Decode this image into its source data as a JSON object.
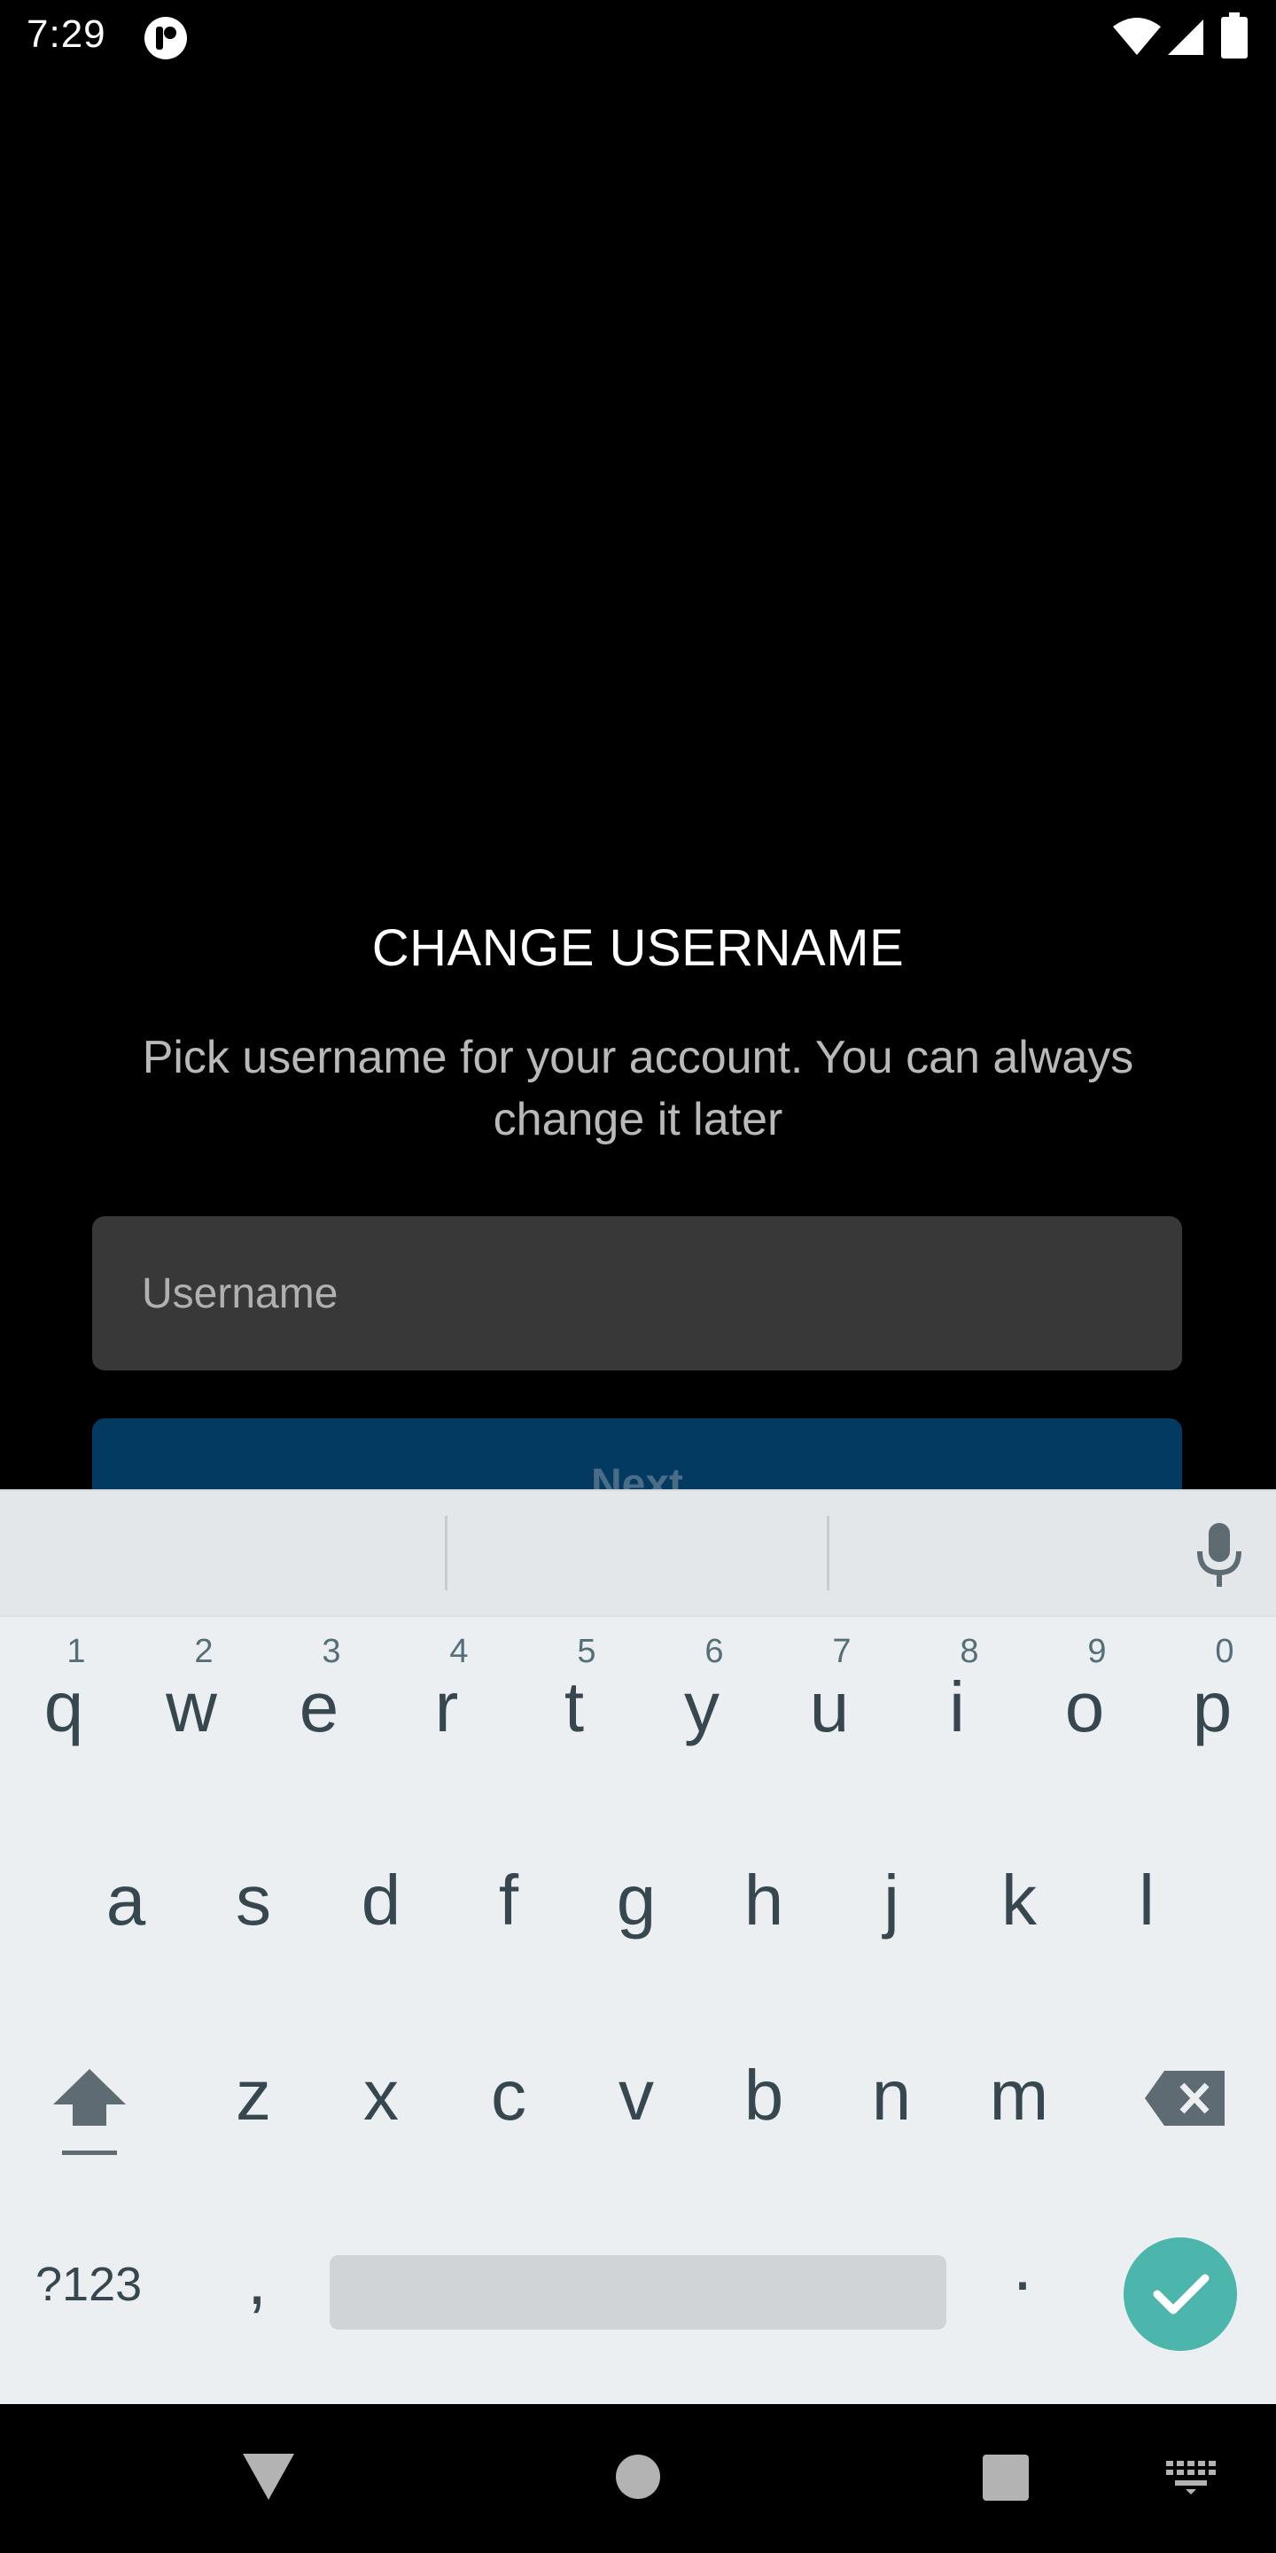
{
  "status_bar": {
    "time": "7:29",
    "icons": [
      "app-notification-icon",
      "wifi-icon",
      "signal-icon",
      "battery-icon"
    ]
  },
  "content": {
    "title": "CHANGE USERNAME",
    "subtitle": "Pick username for your account. You can always change it later",
    "username_placeholder": "Username",
    "username_value": "",
    "next_label": "Next"
  },
  "keyboard": {
    "row1": [
      {
        "key": "q",
        "hint": "1"
      },
      {
        "key": "w",
        "hint": "2"
      },
      {
        "key": "e",
        "hint": "3"
      },
      {
        "key": "r",
        "hint": "4"
      },
      {
        "key": "t",
        "hint": "5"
      },
      {
        "key": "y",
        "hint": "6"
      },
      {
        "key": "u",
        "hint": "7"
      },
      {
        "key": "i",
        "hint": "8"
      },
      {
        "key": "o",
        "hint": "9"
      },
      {
        "key": "p",
        "hint": "0"
      }
    ],
    "row2": [
      "a",
      "s",
      "d",
      "f",
      "g",
      "h",
      "j",
      "k",
      "l"
    ],
    "row3": [
      "z",
      "x",
      "c",
      "v",
      "b",
      "n",
      "m"
    ],
    "symbols_label": "?123",
    "comma_label": ",",
    "period_label": "."
  },
  "colors": {
    "background": "#000000",
    "field": "#383838",
    "next_button": "#023a62",
    "keyboard_bg": "#eceff1",
    "done_key": "#4db6ac"
  }
}
